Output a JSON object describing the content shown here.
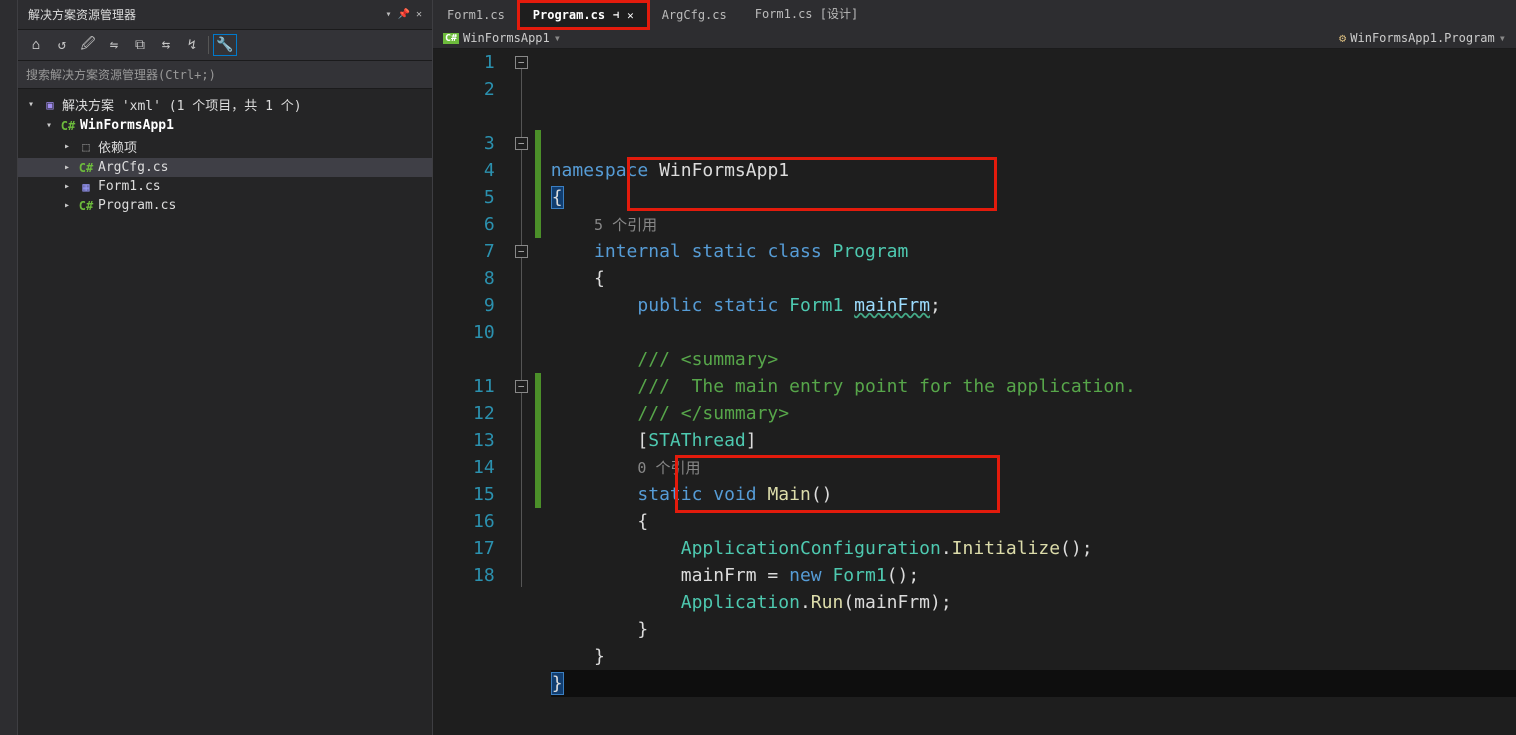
{
  "explorer": {
    "title": "解决方案资源管理器",
    "search": "搜索解决方案资源管理器(Ctrl+;)",
    "toolbar": [
      "⌂",
      "↺",
      "🖉",
      "⇋",
      "⧉",
      "⇆",
      "↯",
      "—",
      "🔧"
    ],
    "nodes": [
      {
        "indent": 0,
        "arrow": "▾",
        "icon": "i-sol",
        "iconTxt": "▣",
        "label": "解决方案 'xml' (1 个项目，共 1 个)",
        "bold": false,
        "sel": false
      },
      {
        "indent": 1,
        "arrow": "▾",
        "icon": "i-csproj",
        "iconTxt": "C#",
        "label": "WinFormsApp1",
        "bold": true,
        "sel": false
      },
      {
        "indent": 2,
        "arrow": "▸",
        "icon": "i-dep",
        "iconTxt": "⬚",
        "label": "依赖项",
        "bold": false,
        "sel": false
      },
      {
        "indent": 2,
        "arrow": "▸",
        "icon": "i-cs",
        "iconTxt": "C#",
        "label": "ArgCfg.cs",
        "bold": false,
        "sel": true
      },
      {
        "indent": 2,
        "arrow": "▸",
        "icon": "i-form",
        "iconTxt": "▦",
        "label": "Form1.cs",
        "bold": false,
        "sel": false
      },
      {
        "indent": 2,
        "arrow": "▸",
        "icon": "i-cs",
        "iconTxt": "C#",
        "label": "Program.cs",
        "bold": false,
        "sel": false
      }
    ]
  },
  "tabs": [
    {
      "label": "Form1.cs",
      "active": false,
      "pin": false,
      "x": false,
      "hilite": false
    },
    {
      "label": "Program.cs",
      "active": true,
      "pin": true,
      "x": true,
      "hilite": true
    },
    {
      "label": "ArgCfg.cs",
      "active": false,
      "pin": false,
      "x": false,
      "hilite": false
    },
    {
      "label": "Form1.cs [设计]",
      "active": false,
      "pin": false,
      "x": false,
      "hilite": false
    }
  ],
  "crumb": {
    "leftIcon": "C#",
    "left": "WinFormsApp1",
    "rightIcon": "⚙",
    "right": "WinFormsApp1.Program"
  },
  "code": {
    "lines": [
      {
        "n": "1",
        "fold": "⊟",
        "html": "<span class='kw'>namespace</span> <span class='pln'>WinFormsApp1</span>"
      },
      {
        "n": "2",
        "fold": "",
        "html": "<span class='brace-hl pln'>{</span>"
      },
      {
        "n": "",
        "fold": "",
        "html": "    <span class='refcnt'>5 个引用</span>"
      },
      {
        "n": "3",
        "fold": "⊟",
        "html": "    <span class='kw'>internal</span> <span class='kw'>static</span> <span class='kw'>class</span> <span class='typ'>Program</span>",
        "bar": true
      },
      {
        "n": "4",
        "fold": "",
        "html": "    <span class='pln'>{</span>",
        "bar": true
      },
      {
        "n": "5",
        "fold": "",
        "html": "        <span class='kw'>public</span> <span class='kw'>static</span> <span class='typ'>Form1</span> <span class='ident squig'>mainFrm</span><span class='pln'>;</span>",
        "bar": true
      },
      {
        "n": "6",
        "fold": "",
        "html": "",
        "bar": true
      },
      {
        "n": "7",
        "fold": "⊟",
        "html": "        <span class='cmt'>/// &lt;summary&gt;</span>"
      },
      {
        "n": "8",
        "fold": "",
        "html": "        <span class='cmt'>///  The main entry point for the application.</span>"
      },
      {
        "n": "9",
        "fold": "",
        "html": "        <span class='cmt'>/// &lt;/summary&gt;</span>"
      },
      {
        "n": "10",
        "fold": "",
        "html": "        <span class='pln'>[</span><span class='typ'>STAThread</span><span class='pln'>]</span>"
      },
      {
        "n": "",
        "fold": "",
        "html": "        <span class='refcnt'>0 个引用</span>"
      },
      {
        "n": "11",
        "fold": "⊟",
        "html": "        <span class='kw'>static</span> <span class='kw'>void</span> <span class='mtd'>Main</span><span class='pln'>()</span>",
        "bar": true
      },
      {
        "n": "12",
        "fold": "",
        "html": "        <span class='pln'>{</span>",
        "bar": true
      },
      {
        "n": "13",
        "fold": "",
        "html": "            <span class='typ'>ApplicationConfiguration</span><span class='pln'>.</span><span class='mtd'>Initialize</span><span class='pln'>();</span>",
        "bar": true
      },
      {
        "n": "14",
        "fold": "",
        "html": "            <span class='pln'>mainFrm = </span><span class='kw'>new</span> <span class='typ'>Form1</span><span class='pln'>();</span>",
        "bar": true
      },
      {
        "n": "15",
        "fold": "",
        "html": "            <span class='typ'>Application</span><span class='pln'>.</span><span class='mtd'>Run</span><span class='pln'>(mainFrm);</span>",
        "bar": true
      },
      {
        "n": "16",
        "fold": "",
        "html": "        <span class='pln'>}</span>"
      },
      {
        "n": "17",
        "fold": "",
        "html": "    <span class='pln'>}</span>"
      },
      {
        "n": "18",
        "fold": "",
        "html": "<span class='brace-hl pln'>}</span>",
        "cursor": true
      }
    ]
  },
  "pinGlyph": "⊣",
  "closeGlyph": "✕",
  "dropGlyph": "▾"
}
